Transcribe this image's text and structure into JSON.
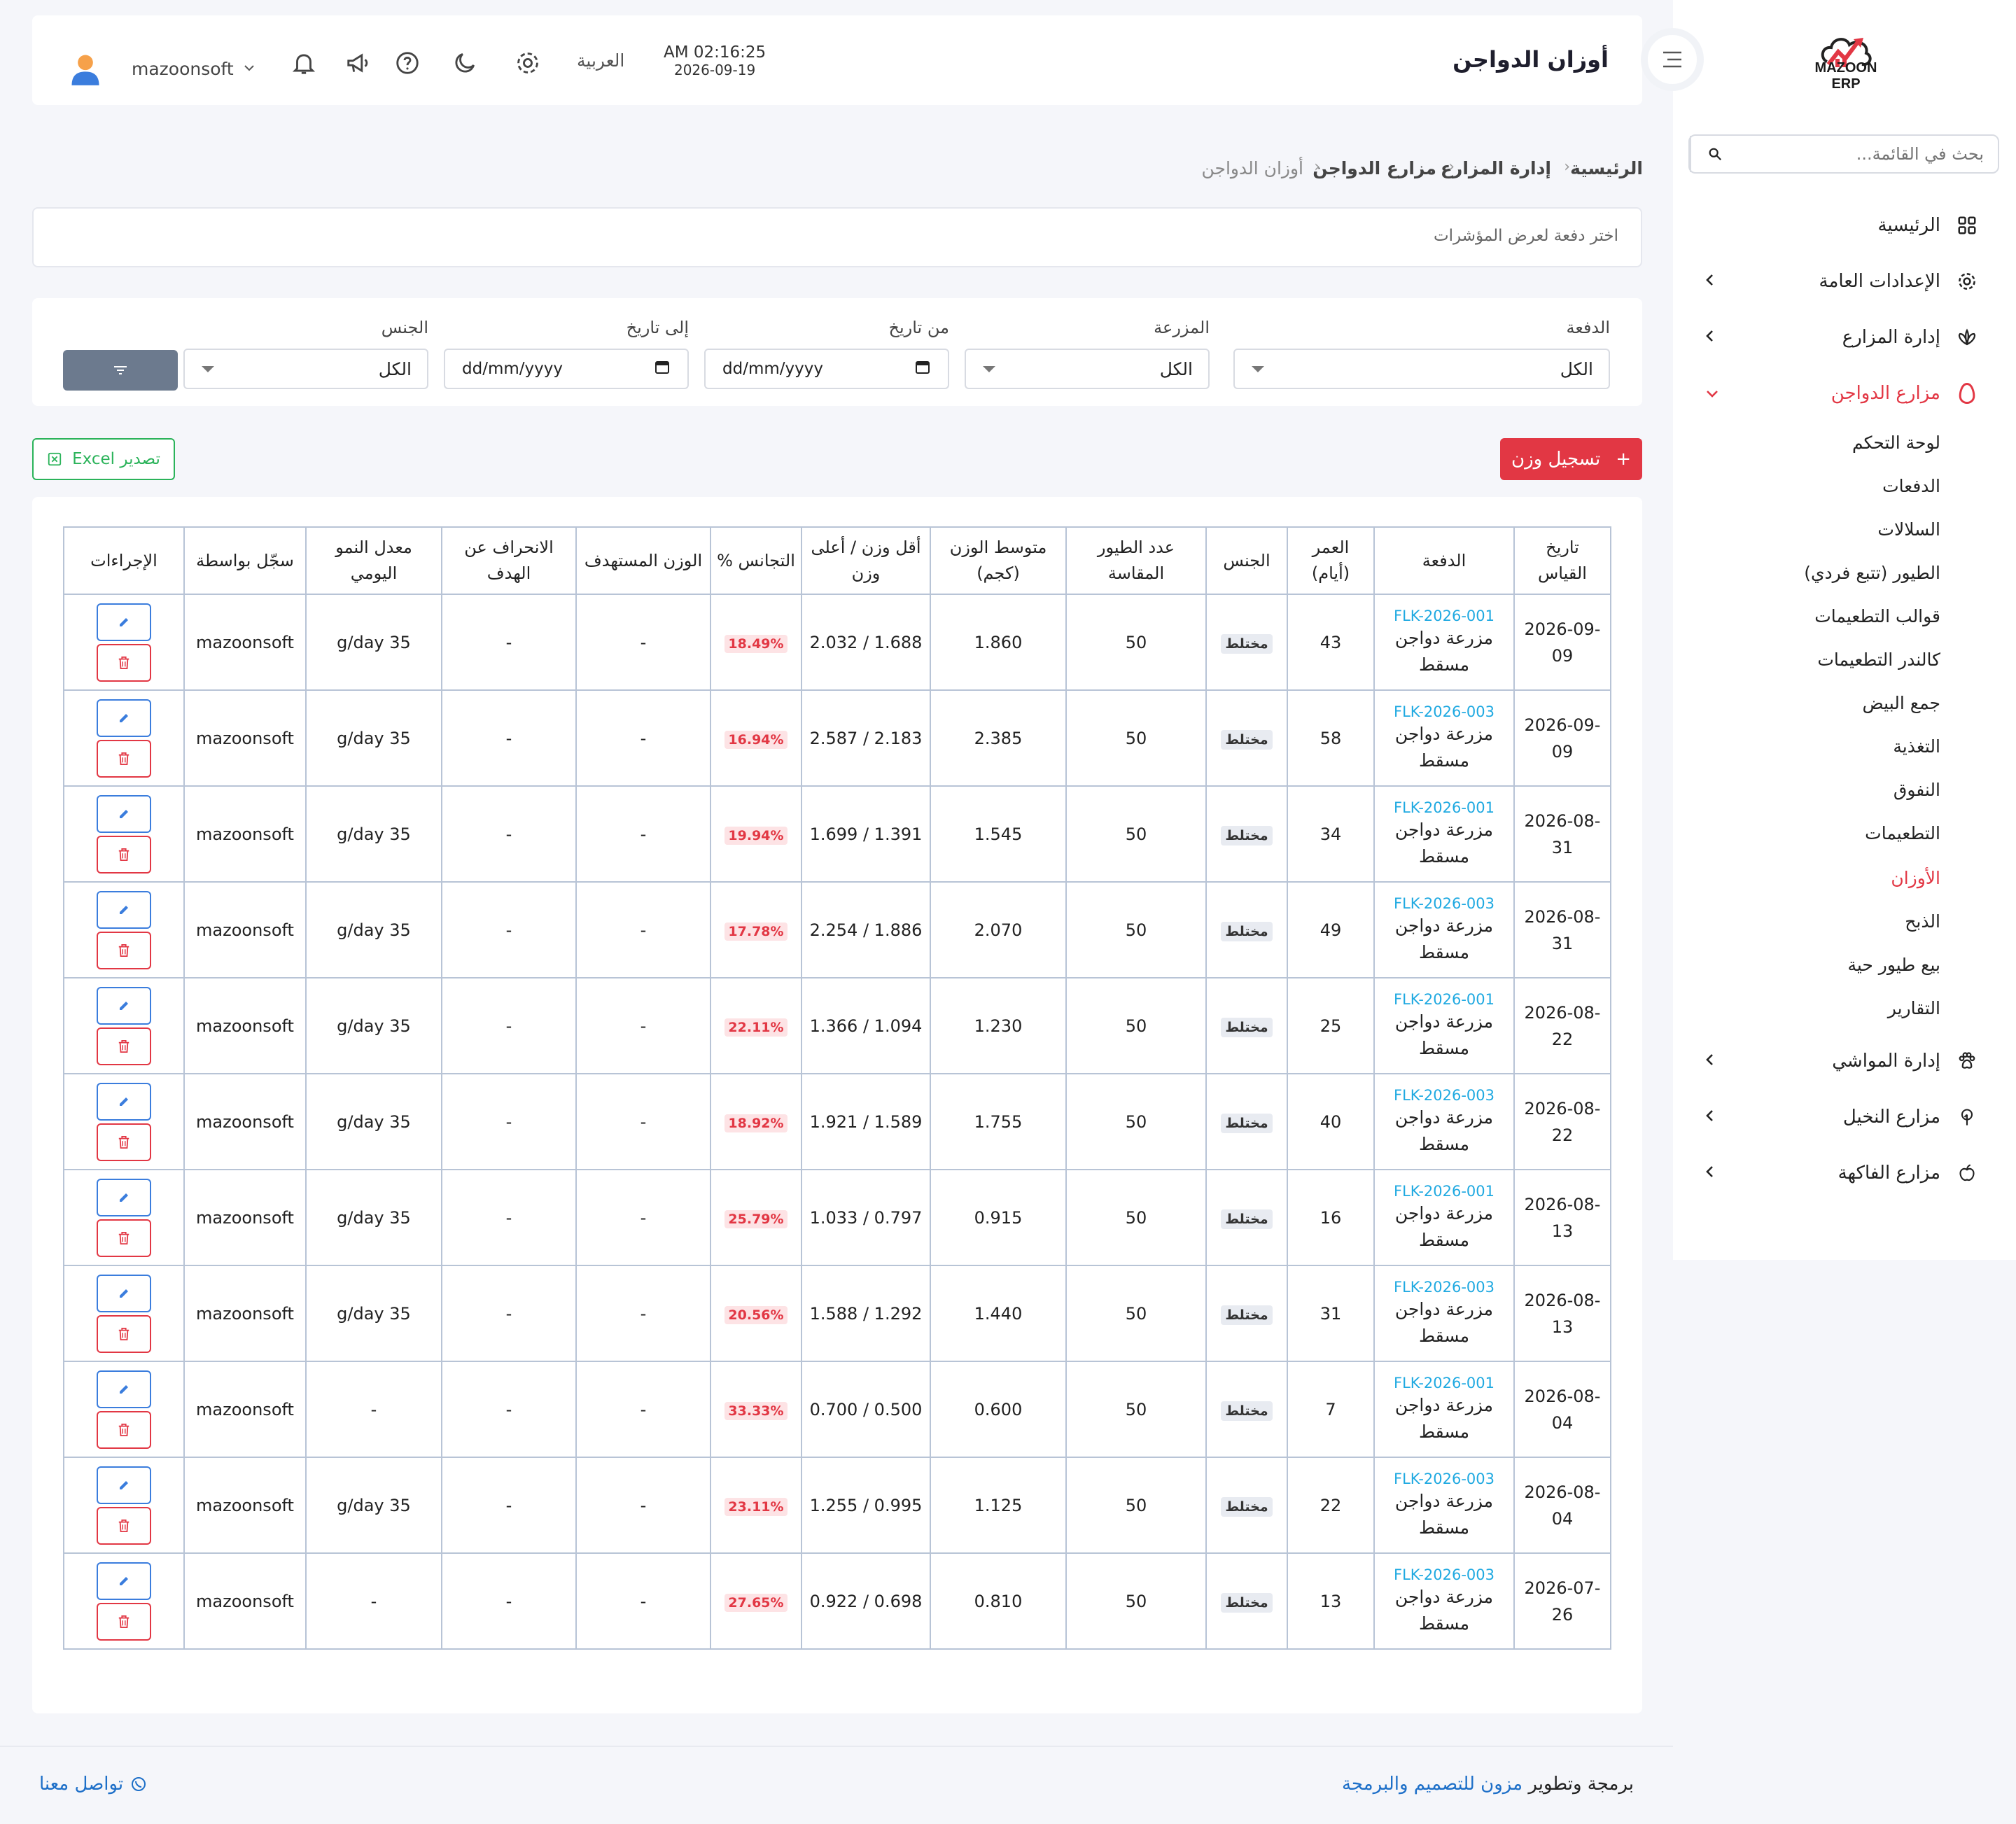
{
  "brand": {
    "logo_text": "MAZOON ERP",
    "logo_sub": "ERP.ازون"
  },
  "header": {
    "title": "أوزان الدواجن",
    "time": "AM 02:16:25",
    "date": "2026-09-19",
    "language": "العربية",
    "username": "mazoonsoft"
  },
  "sidebar": {
    "search_placeholder": "بحث في القائمة...",
    "items": [
      {
        "label": "الرئيسية",
        "icon": "grid-icon"
      },
      {
        "label": "الإعدادات العامة",
        "icon": "gear-icon"
      },
      {
        "label": "إدارة المزارع",
        "icon": "leaf-icon"
      },
      {
        "label": "مزارع الدواجن",
        "icon": "egg-icon"
      },
      {
        "label": "إدارة المواشي",
        "icon": "paw-icon"
      },
      {
        "label": "مزارع النخيل",
        "icon": "palm-icon"
      },
      {
        "label": "مزارع الفاكهة",
        "icon": "apple-icon"
      }
    ],
    "sub_items": [
      "لوحة التحكم",
      "الدفعات",
      "السلالات",
      "الطيور (تتبع فردي)",
      "قوالب التطعيمات",
      "كالندر التطعيمات",
      "جمع البيض",
      "التغذية",
      "النفوق",
      "التطعيمات",
      "الأوزان",
      "الذبح",
      "بيع طيور حية",
      "التقارير"
    ]
  },
  "breadcrumb": [
    "الرئيسية",
    "إدارة المزارع",
    "مزارع الدواجن",
    "أوزان الدواجن"
  ],
  "info_text": "اختر دفعة لعرض المؤشرات",
  "filters": {
    "batch": {
      "label": "الدفعة",
      "value": "الكل"
    },
    "farm": {
      "label": "المزرعة",
      "value": "الكل"
    },
    "from_date": {
      "label": "من تاريخ",
      "value": "dd/mm/yyyy"
    },
    "to_date": {
      "label": "إلى تاريخ",
      "value": "dd/mm/yyyy"
    },
    "gender": {
      "label": "الجنس",
      "value": "الكل"
    }
  },
  "actions": {
    "add_label": "تسجيل وزن",
    "add_prefix": "+",
    "export_label": "تصدير Excel"
  },
  "table": {
    "headers": [
      "تاريخ القياس",
      "الدفعة",
      "العمر (أيام)",
      "الجنس",
      "عدد الطيور المقاسة",
      "متوسط الوزن (كجم)",
      "أقل وزن / أعلى وزن",
      "التجانس %",
      "الوزن المستهدف",
      "الانحراف عن الهدف",
      "معدل النمو اليومي",
      "سجّل بواسطة",
      "الإجراءات"
    ],
    "rows": [
      {
        "date": "2026-09-09",
        "code": "FLK-2026-001",
        "farm": "مزرعة دواجن مسقط",
        "age": "43",
        "gender": "مختلط",
        "count": "50",
        "avg": "1.860",
        "minmax": "1.688 / 2.032",
        "uniformity": "18.49%",
        "target": "-",
        "deviation": "-",
        "growth": "35 g/day",
        "by": "mazoonsoft"
      },
      {
        "date": "2026-09-09",
        "code": "FLK-2026-003",
        "farm": "مزرعة دواجن مسقط",
        "age": "58",
        "gender": "مختلط",
        "count": "50",
        "avg": "2.385",
        "minmax": "2.183 / 2.587",
        "uniformity": "16.94%",
        "target": "-",
        "deviation": "-",
        "growth": "35 g/day",
        "by": "mazoonsoft"
      },
      {
        "date": "2026-08-31",
        "code": "FLK-2026-001",
        "farm": "مزرعة دواجن مسقط",
        "age": "34",
        "gender": "مختلط",
        "count": "50",
        "avg": "1.545",
        "minmax": "1.391 / 1.699",
        "uniformity": "19.94%",
        "target": "-",
        "deviation": "-",
        "growth": "35 g/day",
        "by": "mazoonsoft"
      },
      {
        "date": "2026-08-31",
        "code": "FLK-2026-003",
        "farm": "مزرعة دواجن مسقط",
        "age": "49",
        "gender": "مختلط",
        "count": "50",
        "avg": "2.070",
        "minmax": "1.886 / 2.254",
        "uniformity": "17.78%",
        "target": "-",
        "deviation": "-",
        "growth": "35 g/day",
        "by": "mazoonsoft"
      },
      {
        "date": "2026-08-22",
        "code": "FLK-2026-001",
        "farm": "مزرعة دواجن مسقط",
        "age": "25",
        "gender": "مختلط",
        "count": "50",
        "avg": "1.230",
        "minmax": "1.094 / 1.366",
        "uniformity": "22.11%",
        "target": "-",
        "deviation": "-",
        "growth": "35 g/day",
        "by": "mazoonsoft"
      },
      {
        "date": "2026-08-22",
        "code": "FLK-2026-003",
        "farm": "مزرعة دواجن مسقط",
        "age": "40",
        "gender": "مختلط",
        "count": "50",
        "avg": "1.755",
        "minmax": "1.589 / 1.921",
        "uniformity": "18.92%",
        "target": "-",
        "deviation": "-",
        "growth": "35 g/day",
        "by": "mazoonsoft"
      },
      {
        "date": "2026-08-13",
        "code": "FLK-2026-001",
        "farm": "مزرعة دواجن مسقط",
        "age": "16",
        "gender": "مختلط",
        "count": "50",
        "avg": "0.915",
        "minmax": "0.797 / 1.033",
        "uniformity": "25.79%",
        "target": "-",
        "deviation": "-",
        "growth": "35 g/day",
        "by": "mazoonsoft"
      },
      {
        "date": "2026-08-13",
        "code": "FLK-2026-003",
        "farm": "مزرعة دواجن مسقط",
        "age": "31",
        "gender": "مختلط",
        "count": "50",
        "avg": "1.440",
        "minmax": "1.292 / 1.588",
        "uniformity": "20.56%",
        "target": "-",
        "deviation": "-",
        "growth": "35 g/day",
        "by": "mazoonsoft"
      },
      {
        "date": "2026-08-04",
        "code": "FLK-2026-001",
        "farm": "مزرعة دواجن مسقط",
        "age": "7",
        "gender": "مختلط",
        "count": "50",
        "avg": "0.600",
        "minmax": "0.500 / 0.700",
        "uniformity": "33.33%",
        "target": "-",
        "deviation": "-",
        "growth": "-",
        "by": "mazoonsoft"
      },
      {
        "date": "2026-08-04",
        "code": "FLK-2026-003",
        "farm": "مزرعة دواجن مسقط",
        "age": "22",
        "gender": "مختلط",
        "count": "50",
        "avg": "1.125",
        "minmax": "0.995 / 1.255",
        "uniformity": "23.11%",
        "target": "-",
        "deviation": "-",
        "growth": "35 g/day",
        "by": "mazoonsoft"
      },
      {
        "date": "2026-07-26",
        "code": "FLK-2026-003",
        "farm": "مزرعة دواجن مسقط",
        "age": "13",
        "gender": "مختلط",
        "count": "50",
        "avg": "0.810",
        "minmax": "0.698 / 0.922",
        "uniformity": "27.65%",
        "target": "-",
        "deviation": "-",
        "growth": "-",
        "by": "mazoonsoft"
      }
    ]
  },
  "footer": {
    "credit_prefix": "برمجة وتطوير",
    "credit_link": "مزون للتصميم والبرمجة",
    "contact": "تواصل معنا"
  },
  "colors": {
    "accent": "#e23744",
    "link": "#1fa9e1",
    "excel": "#2bb35a",
    "filter_btn": "#6c7a8e"
  }
}
